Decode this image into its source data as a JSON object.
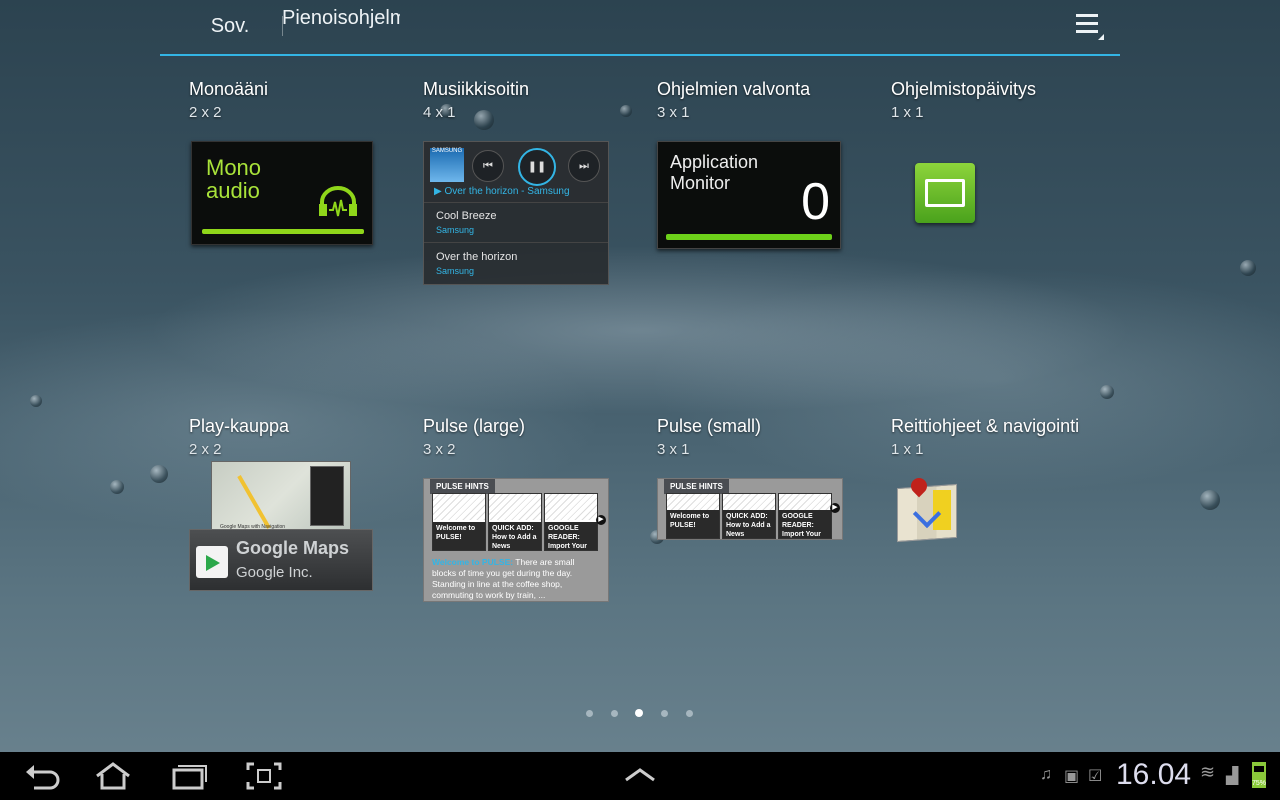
{
  "tabs": {
    "apps_label": "Sov.",
    "widgets_label": "Pienoisohjelmat"
  },
  "widgets": [
    {
      "title": "Monoääni",
      "size": "2 x 2"
    },
    {
      "title": "Musiikkisoitin",
      "size": "4 x 1"
    },
    {
      "title": "Ohjelmien valvonta",
      "size": "3 x 1"
    },
    {
      "title": "Ohjelmistopäivitys",
      "size": "1 x 1"
    },
    {
      "title": "Play-kauppa",
      "size": "2 x 2"
    },
    {
      "title": "Pulse (large)",
      "size": "3 x 2"
    },
    {
      "title": "Pulse (small)",
      "size": "3 x 1"
    },
    {
      "title": "Reittiohjeet & navigointi",
      "size": "1 x 1"
    }
  ],
  "mono_preview": {
    "line1": "Mono",
    "line2": "audio"
  },
  "music_preview": {
    "album_label": "SAMSUNG",
    "now_playing": "▶  Over the horizon - Samsung",
    "tracks": [
      {
        "name": "Cool Breeze",
        "artist": "Samsung"
      },
      {
        "name": "Over the horizon",
        "artist": "Samsung"
      }
    ]
  },
  "appmon_preview": {
    "line1": "Application",
    "line2": "Monitor",
    "count": "0"
  },
  "play_preview": {
    "app_name": "Google Maps",
    "developer": "Google Inc.",
    "caption": "Google Maps with Navigation"
  },
  "pulse_large": {
    "hint": "PULSE HINTS",
    "stories": [
      "Welcome to PULSE!",
      "QUICK ADD: How to Add a News",
      "GOOGLE READER: Import Your"
    ],
    "desc_highlight": "Welcome to PULSE:",
    "desc_text": " There are small blocks of time you get during the day. Standing in line at the coffee shop, commuting to work by train, ..."
  },
  "pulse_small": {
    "hint": "PULSE HINTS",
    "stories": [
      "Welcome to PULSE!",
      "QUICK ADD: How to Add a News",
      "GOOGLE READER: Import Your"
    ]
  },
  "pager": {
    "count": 5,
    "active_index": 2
  },
  "status": {
    "time": "16.04",
    "battery": "75%"
  },
  "colors": {
    "accent": "#33b5e5",
    "green": "#8fd61a"
  }
}
